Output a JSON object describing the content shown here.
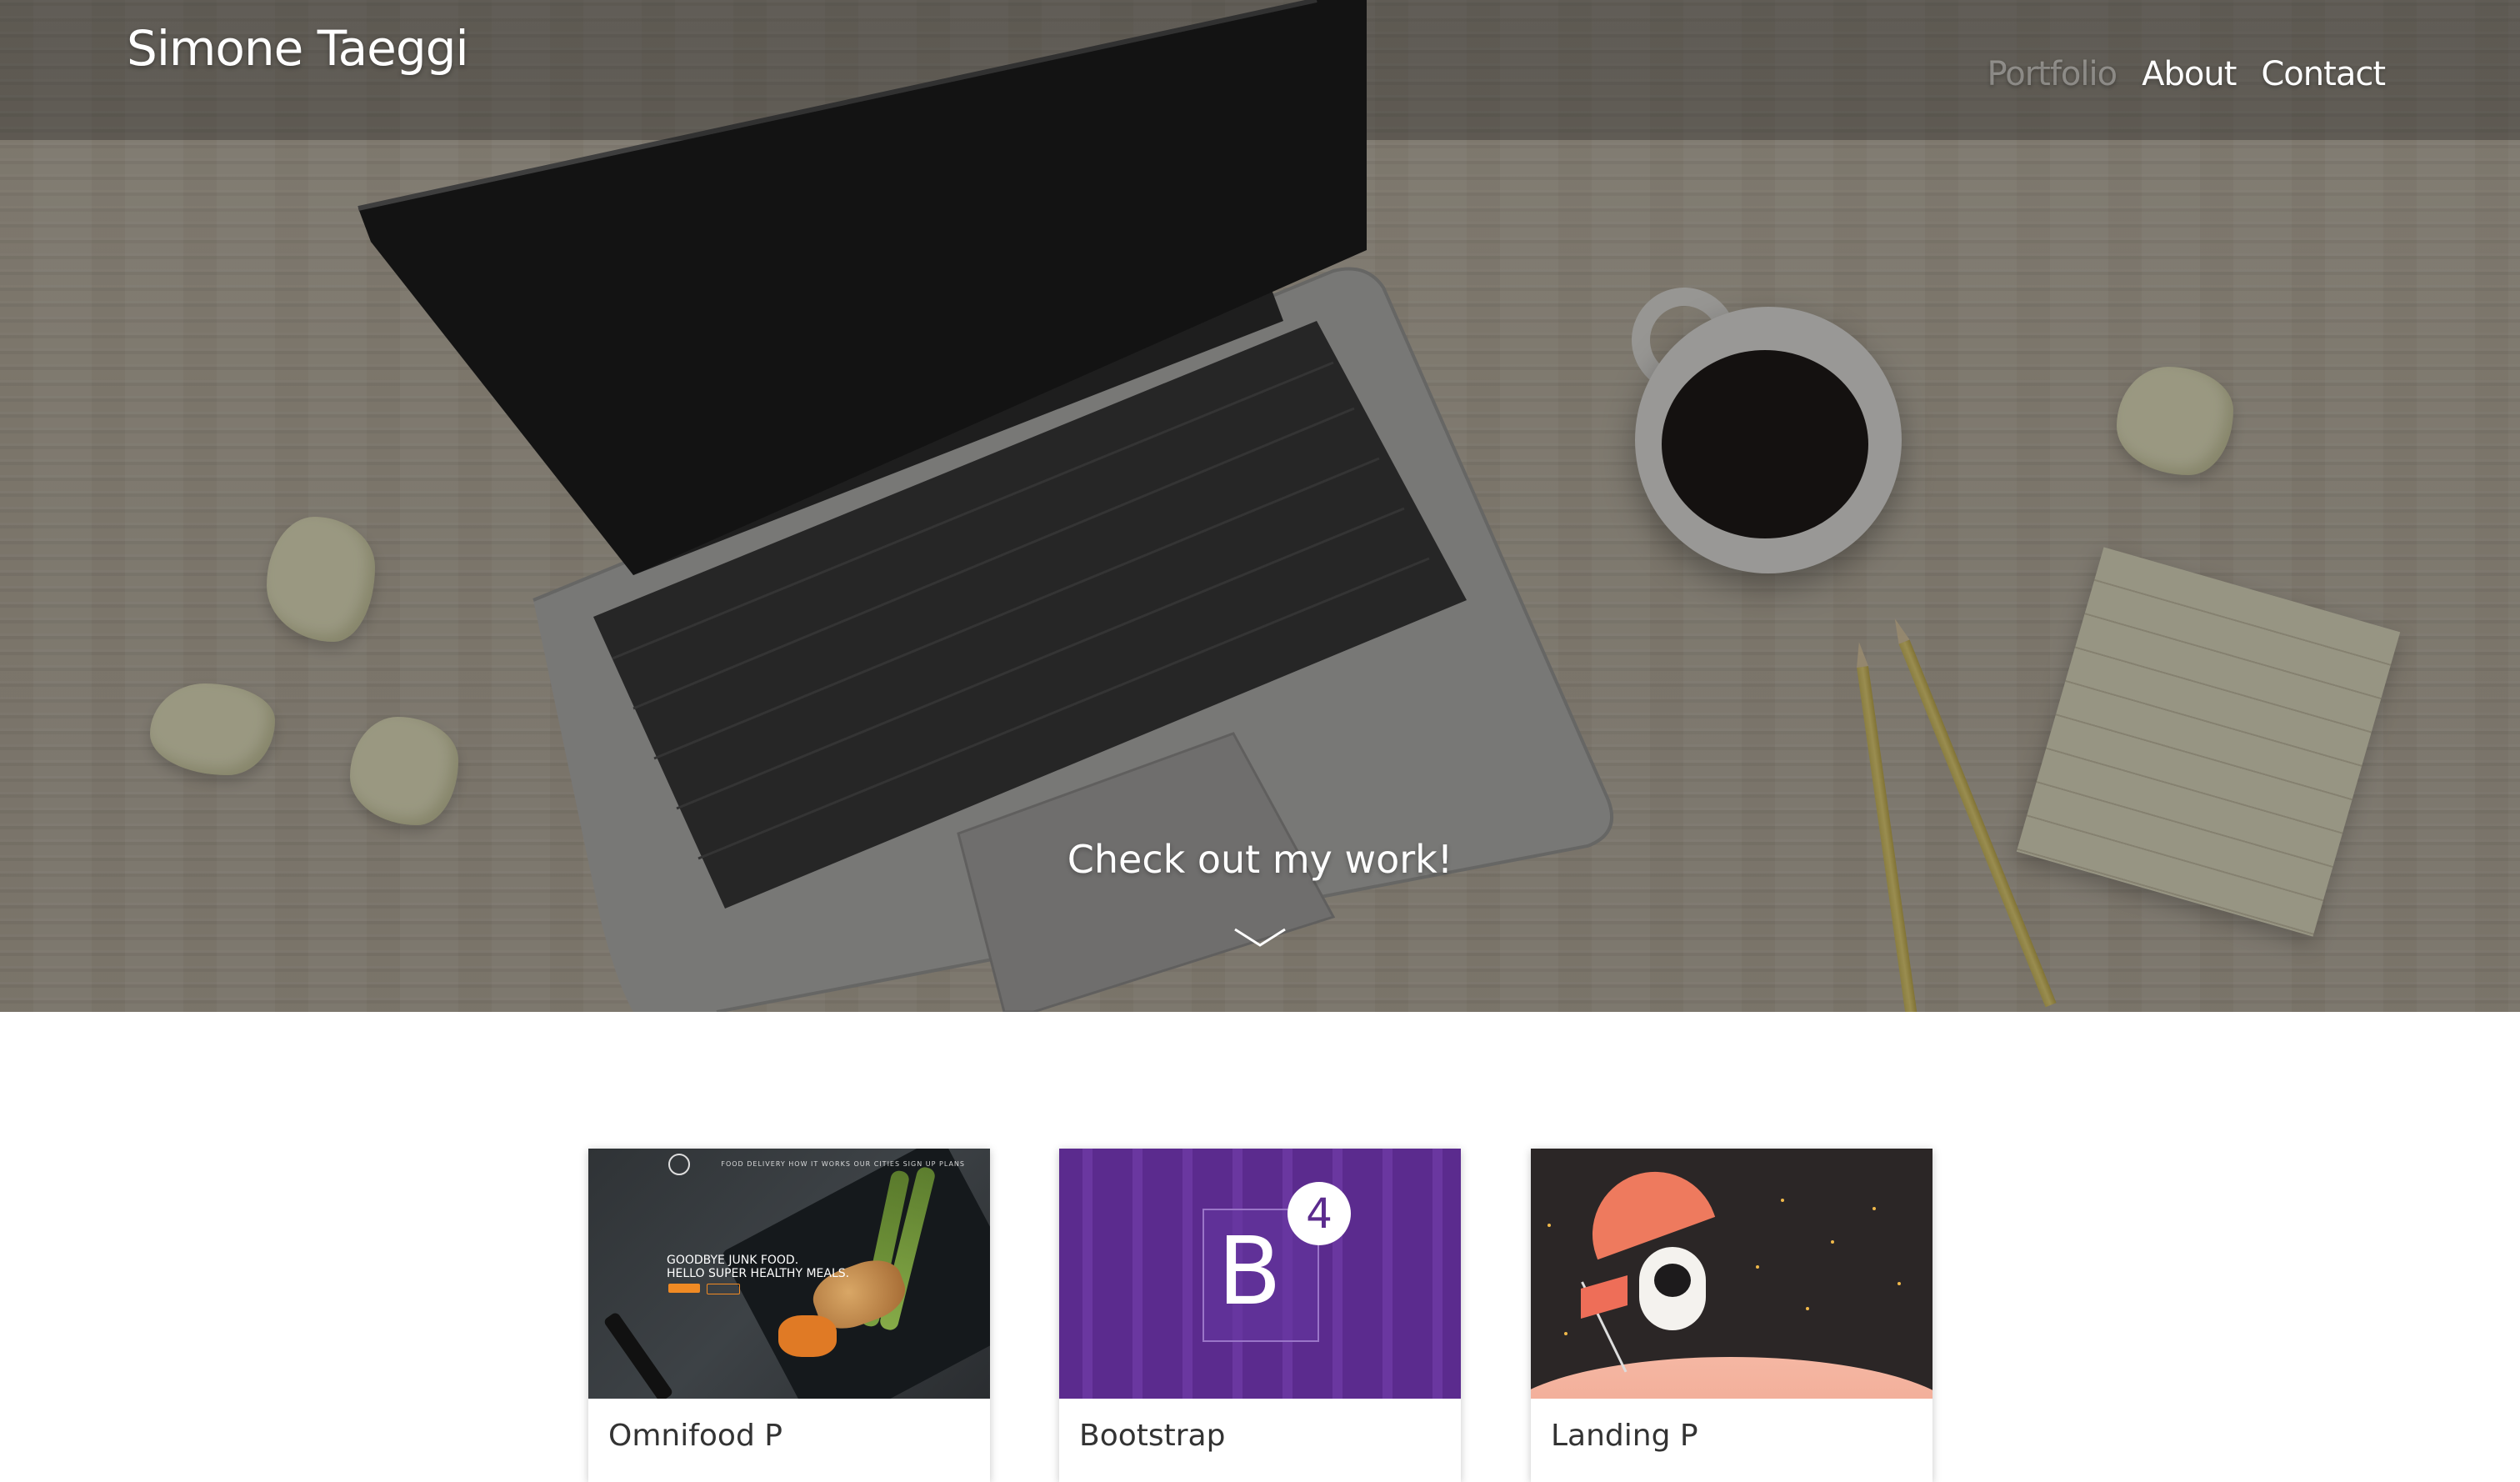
{
  "header": {
    "brand": "Simone Taeggi",
    "nav": [
      {
        "label": "Portfolio",
        "active": true
      },
      {
        "label": "About",
        "active": false
      },
      {
        "label": "Contact",
        "active": false
      }
    ]
  },
  "hero": {
    "cta": "Check out my work!",
    "scroll_icon": "chevron-down-icon"
  },
  "cards": [
    {
      "title": "Omnifood P",
      "thumb_nav": "FOOD DELIVERY   HOW IT WORKS   OUR CITIES   SIGN UP   PLANS",
      "thumb_headline_1": "GOODBYE JUNK FOOD.",
      "thumb_headline_2": "HELLO SUPER HEALTHY MEALS."
    },
    {
      "title": "Bootstrap",
      "logo_letter": "B",
      "badge": "4"
    },
    {
      "title": "Landing P"
    }
  ],
  "colors": {
    "nav_active": "#8a8a8a",
    "bootstrap_purple": "#5b2b8e",
    "omnifood_orange": "#f08a24",
    "space_bg": "#2b2626"
  }
}
